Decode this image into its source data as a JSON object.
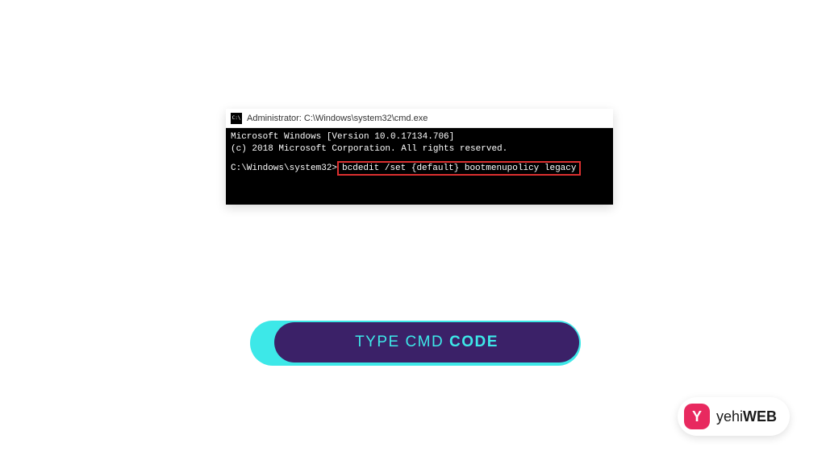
{
  "cmd": {
    "title": "Administrator: C:\\Windows\\system32\\cmd.exe",
    "line1": "Microsoft Windows [Version 10.0.17134.706]",
    "line2": "(c) 2018 Microsoft Corporation. All rights reserved.",
    "prompt": "C:\\Windows\\system32>",
    "command": "bcdedit /set {default} bootmenupolicy legacy"
  },
  "badge": {
    "text_normal": "TYPE CMD ",
    "text_bold": "CODE"
  },
  "logo": {
    "icon_letter": "Y",
    "text1": "yehi",
    "text2": "WEB"
  }
}
